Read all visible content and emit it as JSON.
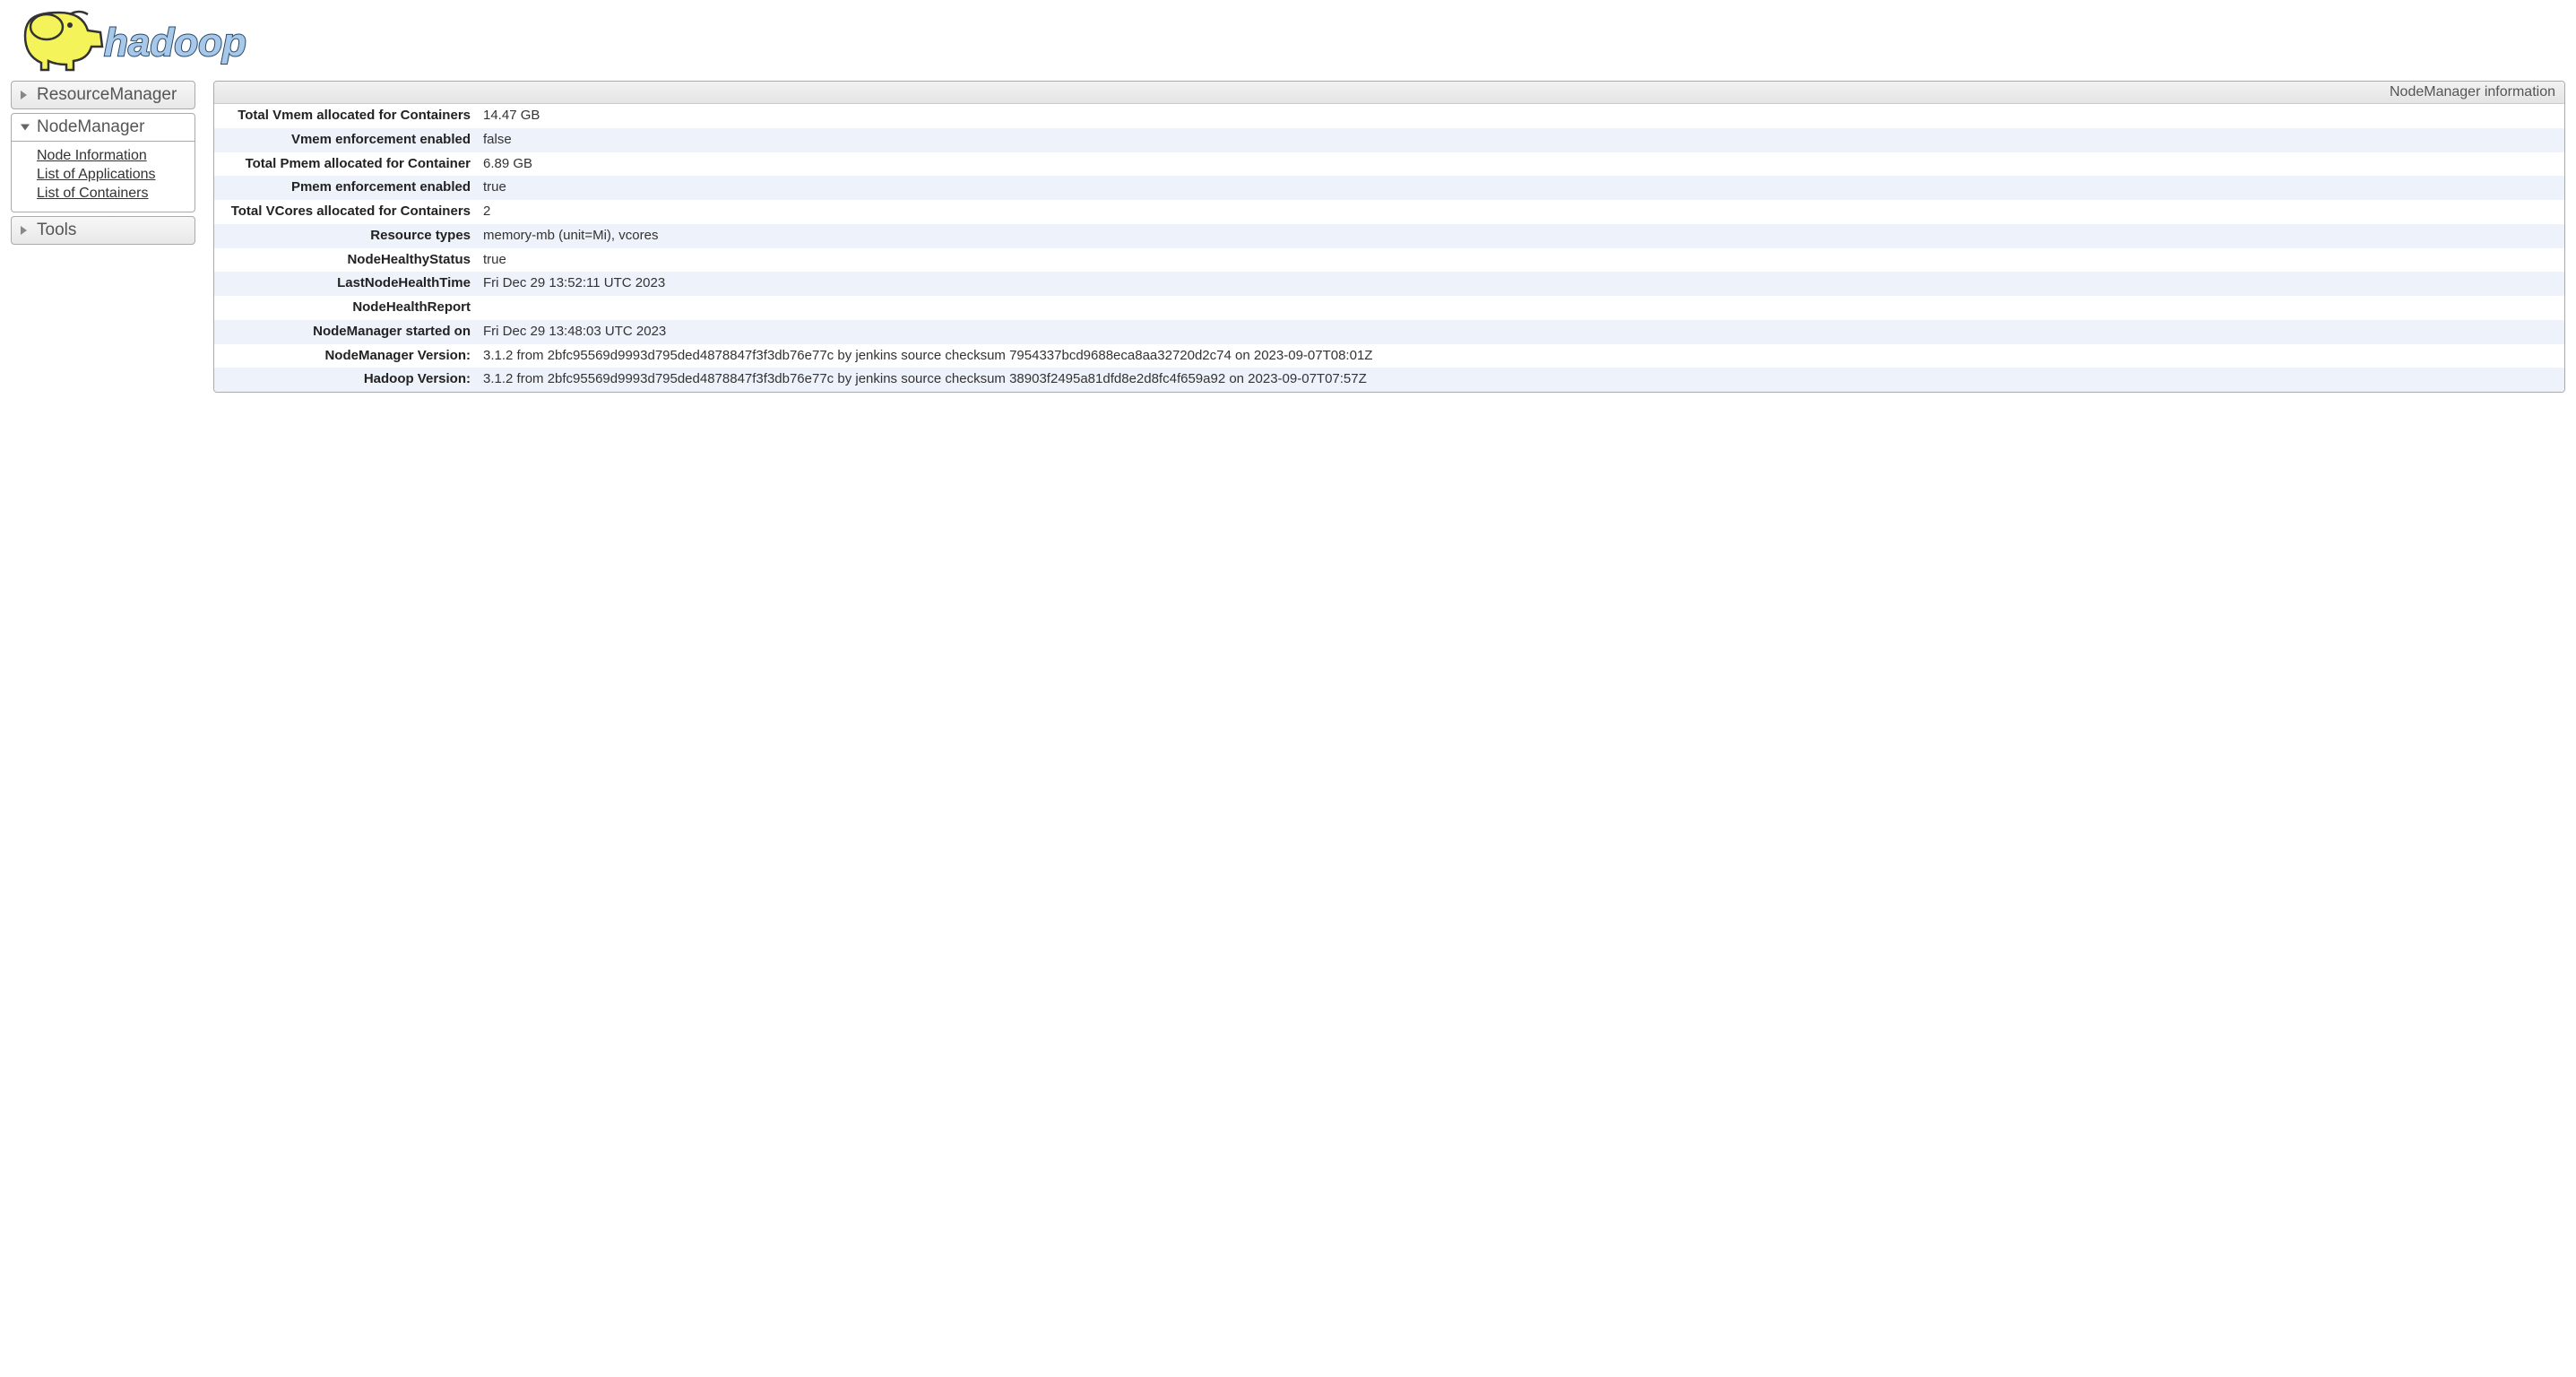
{
  "logo_text": "hadoop",
  "sidebar": {
    "resource_manager_label": "ResourceManager",
    "node_manager_label": "NodeManager",
    "tools_label": "Tools",
    "nm_links": {
      "node_info": "Node Information",
      "list_apps": "List of Applications",
      "list_containers": "List of Containers"
    }
  },
  "title": "NodeManager information",
  "rows": [
    {
      "label": "Total Vmem allocated for Containers",
      "value": "14.47 GB"
    },
    {
      "label": "Vmem enforcement enabled",
      "value": "false"
    },
    {
      "label": "Total Pmem allocated for Container",
      "value": "6.89 GB"
    },
    {
      "label": "Pmem enforcement enabled",
      "value": "true"
    },
    {
      "label": "Total VCores allocated for Containers",
      "value": "2"
    },
    {
      "label": "Resource types",
      "value": "memory-mb (unit=Mi), vcores"
    },
    {
      "label": "NodeHealthyStatus",
      "value": "true"
    },
    {
      "label": "LastNodeHealthTime",
      "value": "Fri Dec 29 13:52:11 UTC 2023"
    },
    {
      "label": "NodeHealthReport",
      "value": ""
    },
    {
      "label": "NodeManager started on",
      "value": "Fri Dec 29 13:48:03 UTC 2023"
    },
    {
      "label": "NodeManager Version:",
      "value": "3.1.2 from 2bfc95569d9993d795ded4878847f3f3db76e77c by jenkins source checksum 7954337bcd9688eca8aa32720d2c74 on 2023-09-07T08:01Z"
    },
    {
      "label": "Hadoop Version:",
      "value": "3.1.2 from 2bfc95569d9993d795ded4878847f3f3db76e77c by jenkins source checksum 38903f2495a81dfd8e2d8fc4f659a92 on 2023-09-07T07:57Z"
    }
  ]
}
